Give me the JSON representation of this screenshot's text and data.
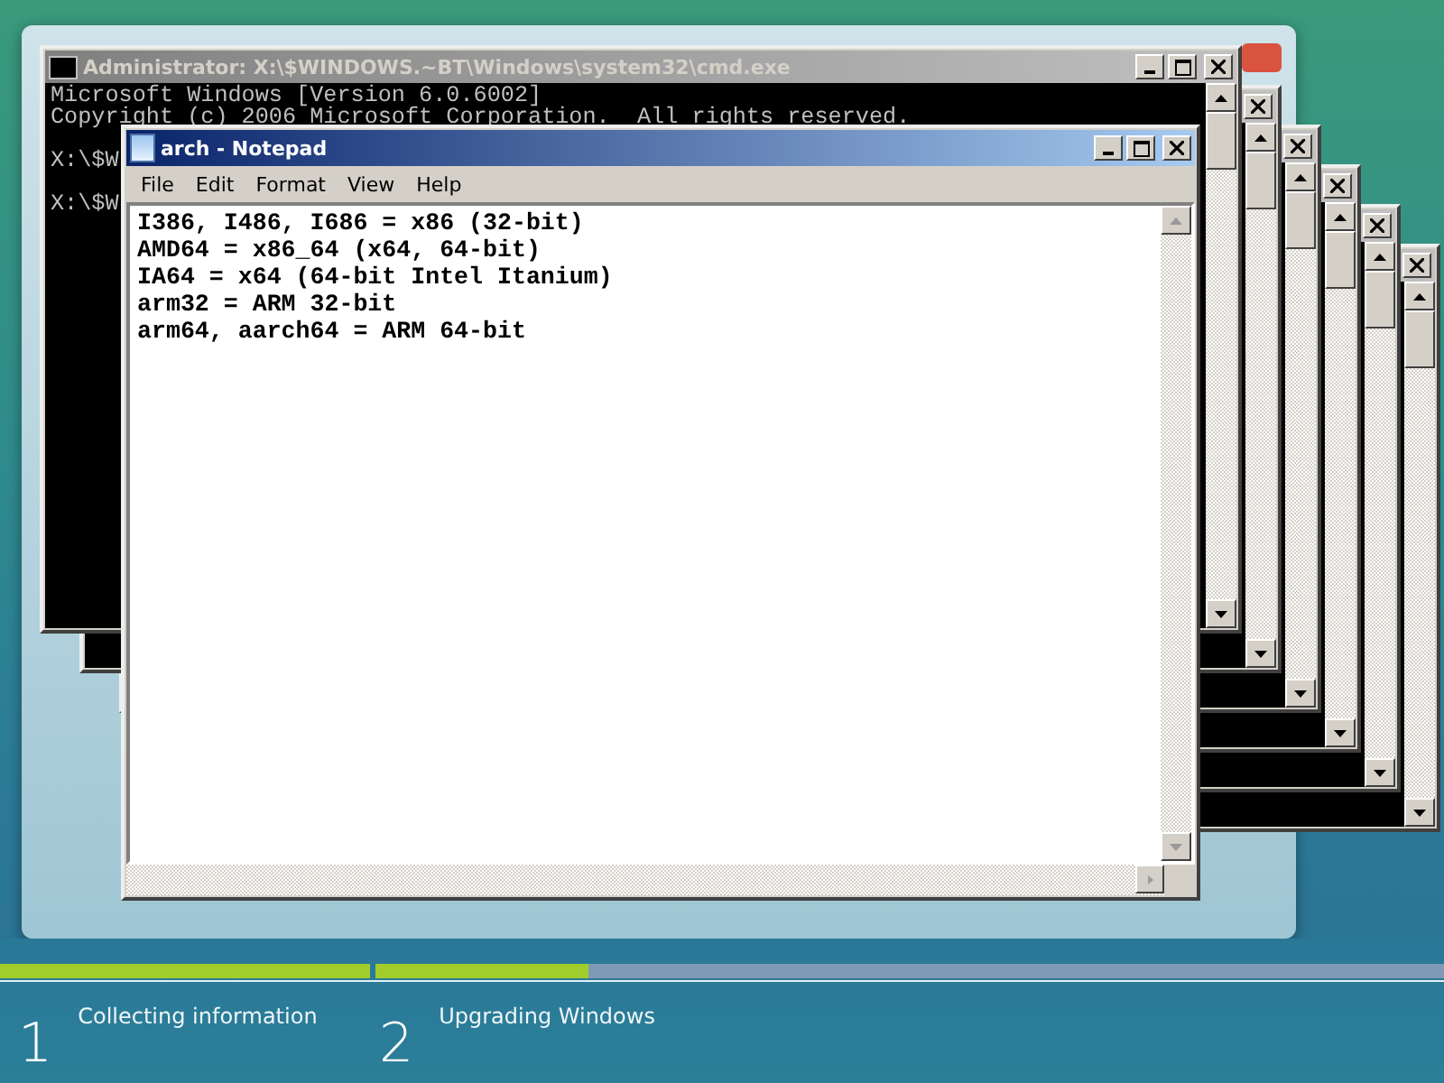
{
  "cmd_window": {
    "title": "Administrator: X:\\$WINDOWS.~BT\\Windows\\system32\\cmd.exe",
    "lines": [
      {
        "kind": "output",
        "text": "Microsoft Windows [Version 6.0.6002]"
      },
      {
        "kind": "output",
        "text": "Copyright (c) 2006 Microsoft Corporation.  All rights reserved."
      },
      {
        "kind": "prompt",
        "text": "X:\\$W"
      },
      {
        "kind": "prompt",
        "text": "X:\\$W"
      }
    ]
  },
  "notepad": {
    "title": "arch - Notepad",
    "menu": [
      "File",
      "Edit",
      "Format",
      "View",
      "Help"
    ],
    "lines": [
      "I386, I486, I686 = x86 (32-bit)",
      "AMD64 = x86_64 (x64, 64-bit)",
      "IA64 = x64 (64-bit Intel Itanium)",
      "arm32 = ARM 32-bit",
      "arm64, aarch64 = ARM 64-bit"
    ]
  },
  "setup_steps": [
    {
      "number": "1",
      "label": "Collecting information",
      "level": 1
    },
    {
      "number": "2",
      "label": "Upgrading Windows",
      "level": 0.2
    }
  ]
}
